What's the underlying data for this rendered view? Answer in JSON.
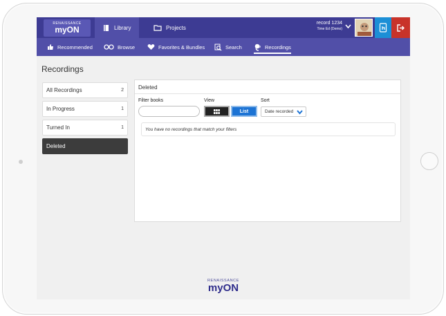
{
  "header": {
    "logo_top": "RENAISSANCE",
    "logo_main": "myON",
    "tabs": [
      {
        "label": "Library",
        "icon": "book-icon",
        "active": true
      },
      {
        "label": "Projects",
        "icon": "folder-icon",
        "active": false
      }
    ],
    "user_name": "record 1234",
    "user_sub": "Time Ed (Demo)"
  },
  "subnav": {
    "items": [
      {
        "label": "Recommended",
        "icon": "thumbs-up-icon"
      },
      {
        "label": "Browse",
        "icon": "glasses-icon"
      },
      {
        "label": "Favorites & Bundles",
        "icon": "heart-icon"
      },
      {
        "label": "Search",
        "icon": "search-icon"
      },
      {
        "label": "Recordings",
        "icon": "microphone-icon",
        "active": true
      }
    ]
  },
  "page": {
    "title": "Recordings"
  },
  "sidebar": {
    "items": [
      {
        "label": "All Recordings",
        "count": "2"
      },
      {
        "label": "In Progress",
        "count": "1"
      },
      {
        "label": "Turned In",
        "count": "1"
      },
      {
        "label": "Deleted",
        "count": "",
        "active": true
      }
    ]
  },
  "panel": {
    "title": "Deleted",
    "filter_label": "Filter books",
    "filter_value": "",
    "view_label": "View",
    "list_button": "List",
    "sort_label": "Sort",
    "sort_value": "Date recorded",
    "empty_message": "You have no recordings that match your filters"
  },
  "footer": {
    "logo_top": "RENAISSANCE",
    "logo_main": "myON"
  },
  "colors": {
    "topbar": "#3d3b93",
    "subnav": "#514fa8",
    "accent_blue": "#1c73d4",
    "logout_red": "#c8332a"
  }
}
